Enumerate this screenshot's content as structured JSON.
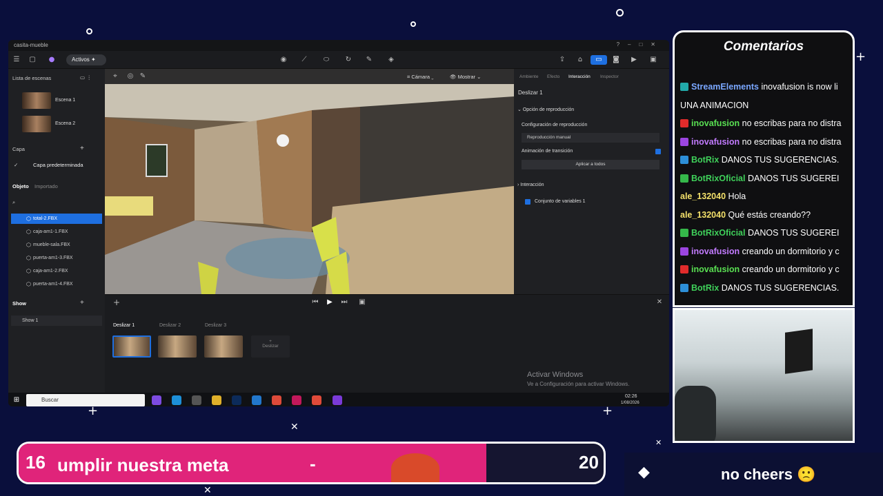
{
  "window": {
    "title": "casita-mueble"
  },
  "toolbar": {
    "activos_label": "Activos"
  },
  "left": {
    "scenes_title": "Lista de escenas",
    "scenes": [
      "Escena 1",
      "Escena 2"
    ],
    "layer_title": "Capa",
    "layer_item": "Capa predeterminada",
    "object_tab": "Objeto",
    "imported_tab": "Importado",
    "objects": [
      "total-2.FBX",
      "caja-am1-1.FBX",
      "mueble-sala.FBX",
      "puerta-am1-3.FBX",
      "caja-am1-2.FBX",
      "puerta-am1-4.FBX"
    ],
    "show_title": "Show",
    "show_item": "Show 1"
  },
  "viewport": {
    "camera_label": "Cámara",
    "show_label": "Mostrar"
  },
  "right": {
    "tabs": [
      "Ambiente",
      "Efecto",
      "Interacción",
      "Inspector"
    ],
    "slide_title": "Deslizar 1",
    "playback_option": "Opción de reproducción",
    "playback_config": "Configuración de reproducción",
    "playback_value": "Reproducción manual",
    "transition_anim": "Animación de transición",
    "apply_all": "Aplicar a todos",
    "interaction": "Interacción",
    "variable_set": "Conjunto de variables 1"
  },
  "slides": {
    "tabs": [
      "Deslizar 1",
      "Deslizar 2",
      "Deslizar 3"
    ],
    "add_label": "Deslizar"
  },
  "activate": {
    "title": "Activar Windows",
    "subtitle": "Ve a Configuración para activar Windows."
  },
  "taskbar": {
    "search_placeholder": "Buscar",
    "time": "02:26",
    "date": "1/08/2026"
  },
  "chat": {
    "title": "Comentarios",
    "messages": [
      {
        "user": "StreamElements",
        "text": "inovafusion is now li",
        "user_color": "#7aa7ff",
        "badge_color": "#2aa"
      },
      {
        "user": "",
        "text": "UNA ANIMACION",
        "user_color": "#fff",
        "badge_color": ""
      },
      {
        "user": "inovafusion",
        "text": "no escribas para no distra",
        "user_color": "#59e052",
        "badge_color": "#e02b2b"
      },
      {
        "user": "inovafusion",
        "text": "no escribas para no distra",
        "user_color": "#c27bff",
        "badge_color": "#9b45e0"
      },
      {
        "user": "BotRix",
        "text": "DANOS TUS SUGERENCIAS.",
        "user_color": "#3fd05a",
        "badge_color": "#2d8fd8"
      },
      {
        "user": "BotRixOficial",
        "text": "DANOS TUS SUGEREI",
        "user_color": "#3fd05a",
        "badge_color": "#35b84a"
      },
      {
        "user": "ale_132040",
        "text": "Hola",
        "user_color": "#f3e06a",
        "badge_color": ""
      },
      {
        "user": "ale_132040",
        "text": "Qué estás creando??",
        "user_color": "#f3e06a",
        "badge_color": ""
      },
      {
        "user": "BotRixOficial",
        "text": "DANOS TUS SUGEREI",
        "user_color": "#3fd05a",
        "badge_color": "#35b84a"
      },
      {
        "user": "inovafusion",
        "text": "creando un dormitorio y c",
        "user_color": "#c27bff",
        "badge_color": "#9b45e0"
      },
      {
        "user": "inovafusion",
        "text": "creando un dormitorio y c",
        "user_color": "#59e052",
        "badge_color": "#e02b2b"
      },
      {
        "user": "BotRix",
        "text": "DANOS TUS SUGERENCIAS.",
        "user_color": "#3fd05a",
        "badge_color": "#2d8fd8"
      }
    ]
  },
  "goal": {
    "start": "16",
    "text": "umplir nuestra meta",
    "dash": "-",
    "end": "20",
    "progress": 0.8
  },
  "cheers": {
    "text": "no cheers 🙁"
  }
}
